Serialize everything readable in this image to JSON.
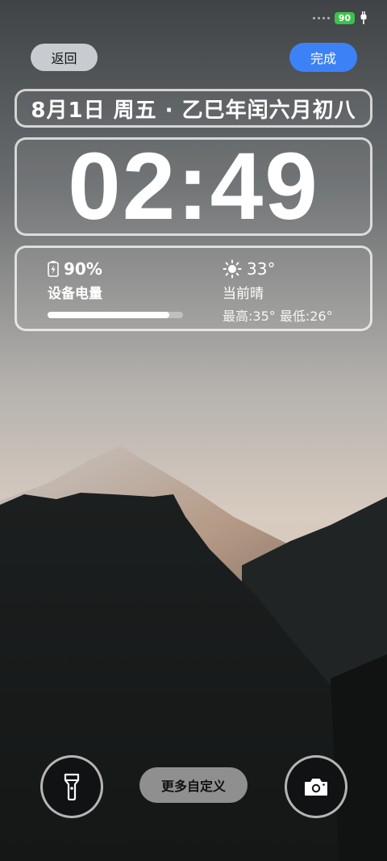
{
  "status": {
    "battery": "90"
  },
  "header": {
    "back_label": "返回",
    "done_label": "完成"
  },
  "date_line": "8月1日 周五 · 乙巳年闰六月初八",
  "clock": {
    "time": "02:49"
  },
  "widget": {
    "battery": {
      "percent_text": "90%",
      "label": "设备电量",
      "level": 0.9
    },
    "weather": {
      "temp": "33°",
      "condition": "当前晴",
      "range": "最高:35° 最低:26°"
    }
  },
  "bottom": {
    "customize_label": "更多自定义"
  },
  "icons": [
    "signal-icon",
    "charging-plug-icon",
    "battery-charging-icon",
    "sun-icon",
    "flashlight-icon",
    "camera-icon"
  ],
  "colors": {
    "done_button": "#3c82f6",
    "back_button": "#c8ccd0",
    "battery_badge": "#3cc24a"
  }
}
